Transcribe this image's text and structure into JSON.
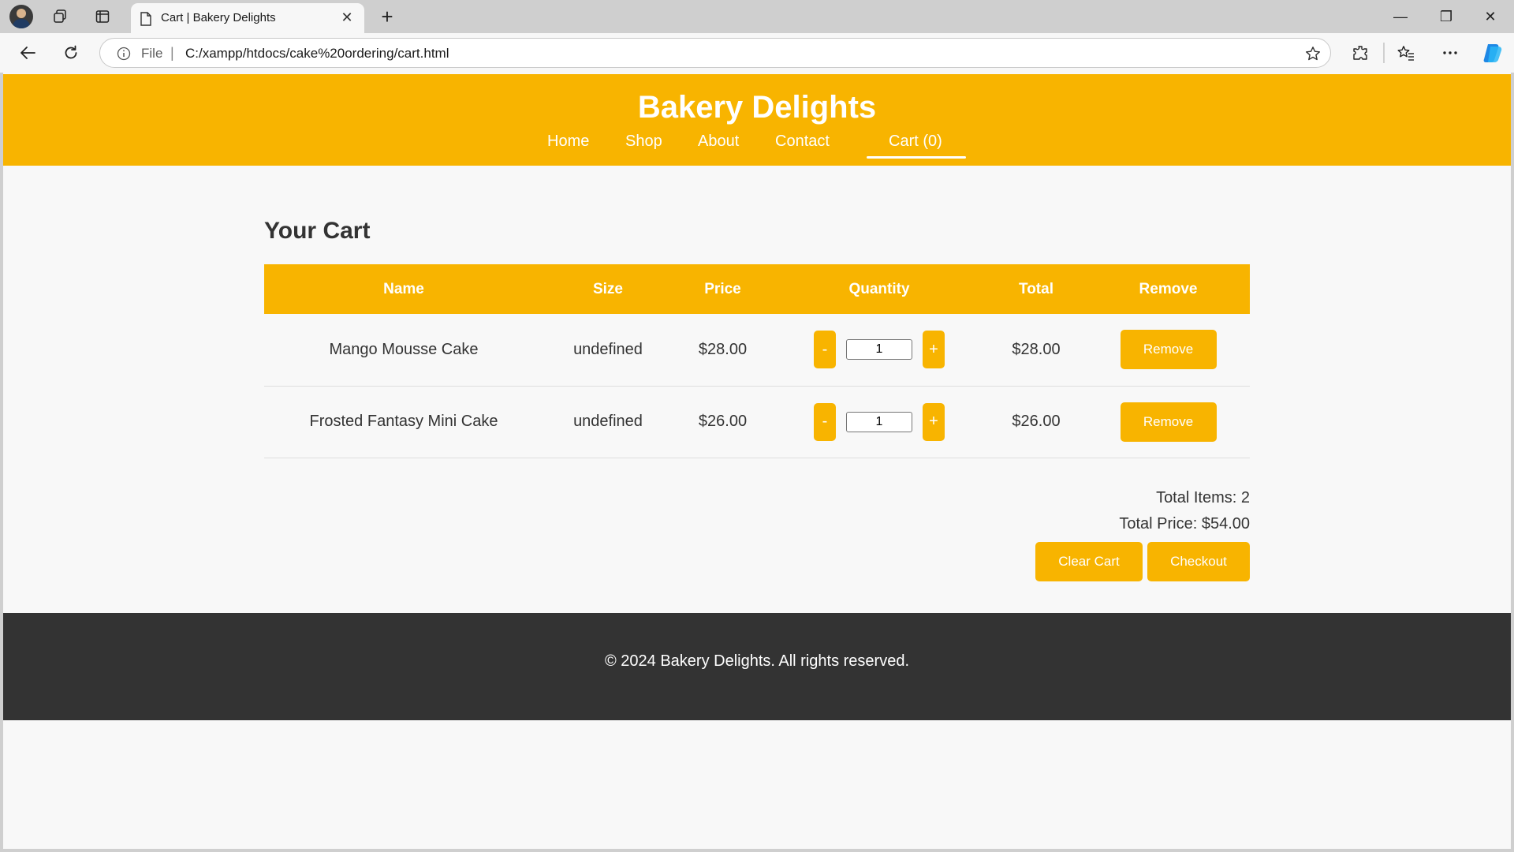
{
  "browser": {
    "tab_title": "Cart | Bakery Delights",
    "tab_close": "✕",
    "new_tab": "+",
    "address_scheme": "File",
    "address_separator": "|",
    "address_url": "C:/xampp/htdocs/cake%20ordering/cart.html",
    "window_controls": {
      "minimize": "—",
      "restore": "❐",
      "close": "✕"
    }
  },
  "site": {
    "title": "Bakery Delights",
    "nav": [
      {
        "label": "Home"
      },
      {
        "label": "Shop"
      },
      {
        "label": "About"
      },
      {
        "label": "Contact"
      },
      {
        "label": "Cart (0)",
        "active": true
      }
    ]
  },
  "cart": {
    "heading": "Your Cart",
    "columns": [
      "Name",
      "Size",
      "Price",
      "Quantity",
      "Total",
      "Remove"
    ],
    "items": [
      {
        "name": "Mango Mousse Cake",
        "size": "undefined",
        "price": "$28.00",
        "quantity": "1",
        "total": "$28.00",
        "remove_label": "Remove",
        "minus": "-",
        "plus": "+"
      },
      {
        "name": "Frosted Fantasy Mini Cake",
        "size": "undefined",
        "price": "$26.00",
        "quantity": "1",
        "total": "$26.00",
        "remove_label": "Remove",
        "minus": "-",
        "plus": "+"
      }
    ],
    "total_items_label": "Total Items: 2",
    "total_price_label": "Total Price: $54.00",
    "clear_label": "Clear Cart",
    "checkout_label": "Checkout"
  },
  "footer": {
    "text": "© 2024 Bakery Delights. All rights reserved."
  },
  "colors": {
    "accent": "#f8b400",
    "footer_bg": "#333333",
    "page_bg": "#f8f8f8"
  }
}
